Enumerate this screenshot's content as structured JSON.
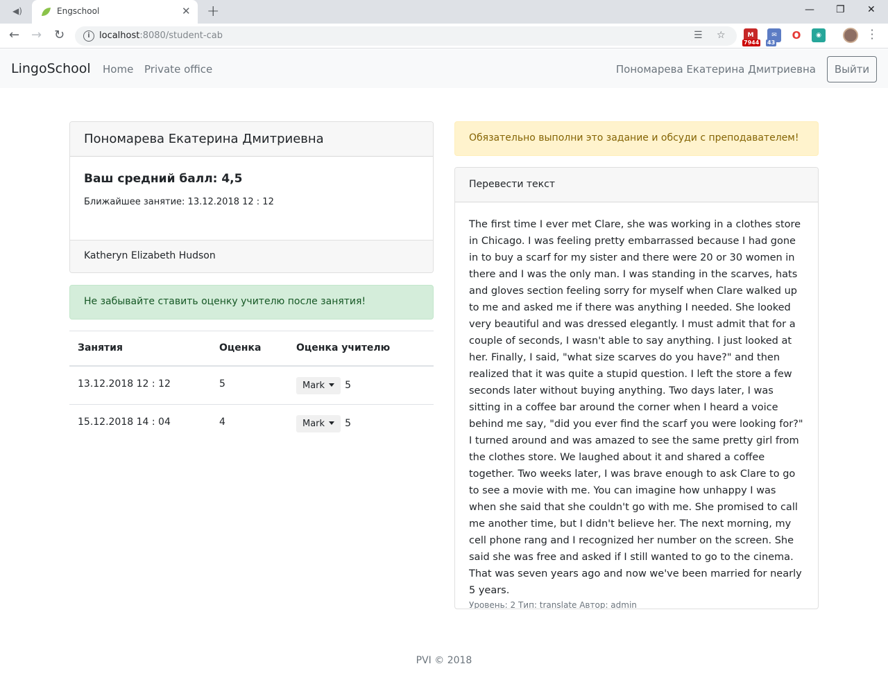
{
  "browser": {
    "tab_title": "Engschool",
    "url_host": "localhost",
    "url_rest": ":8080/student-cab",
    "ext_badge_1": "7944",
    "ext_badge_2": "43"
  },
  "navbar": {
    "brand": "LingoSchool",
    "links": [
      "Home",
      "Private office"
    ],
    "user_name": "Пономарева Екатерина Дмитриевна",
    "logout_label": "Выйти"
  },
  "profile": {
    "name": "Пономарева Екатерина Дмитриевна",
    "average_label": "Ваш средний балл: 4,5",
    "next_lesson": "Ближайшее занятие: 13.12.2018 12 : 12",
    "teacher": "Katheryn Elizabeth Hudson"
  },
  "reminder": "Не забывайте ставить оценку учителю после занятия!",
  "lessons_table": {
    "headers": [
      "Занятия",
      "Оценка",
      "Оценка учителю"
    ],
    "rows": [
      {
        "date": "13.12.2018 12 : 12",
        "grade": "5",
        "mark_label": "Mark",
        "teacher_rating": "5"
      },
      {
        "date": "15.12.2018 14 : 04",
        "grade": "4",
        "mark_label": "Mark",
        "teacher_rating": "5"
      }
    ]
  },
  "task": {
    "warning": "Обязательно выполни это задание и обсуди с преподавателем!",
    "title": "Перевести текст",
    "text": "The first time I ever met Clare, she was working in a clothes store in Chicago. I was feeling pretty embarrassed because I had gone in to buy a scarf for my sister and there were 20 or 30 women in there and I was the only man. I was standing in the scarves, hats and gloves section feeling sorry for myself when Clare walked up to me and asked me if there was anything I needed. She looked very beautiful and was dressed elegantly. I must admit that for a couple of seconds, I wasn't able to say anything. I just looked at her. Finally, I said, \"what size scarves do you have?\" and then realized that it was quite a stupid question. I left the store a few seconds later without buying anything. Two days later, I was sitting in a coffee bar around the corner when I heard a voice behind me say, \"did you ever find the scarf you were looking for?\" I turned around and was amazed to see the same pretty girl from the clothes store. We laughed about it and shared a coffee together. Two weeks later, I was brave enough to ask Clare to go to see a movie with me. You can imagine how unhappy I was when she said that she couldn't go with me. She promised to call me another time, but I didn't believe her. The next morning, my cell phone rang and I recognized her number on the screen. She said she was free and asked if I still wanted to go to the cinema. That was seven years ago and now we've been married for nearly 5 years.",
    "meta": "Уровень: 2 Тип: translate Автор: admin"
  },
  "footer": "PVI © 2018"
}
